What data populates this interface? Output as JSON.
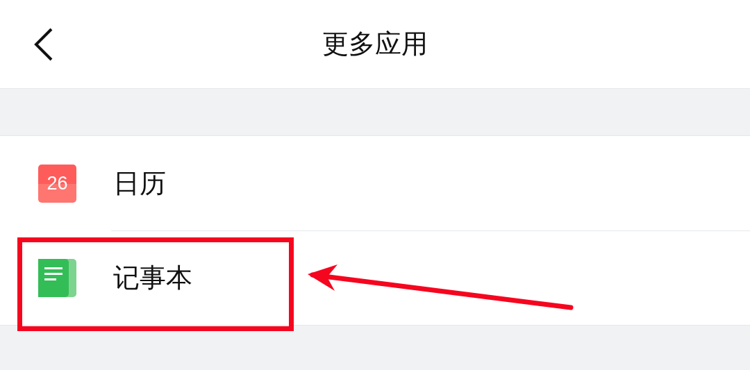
{
  "header": {
    "title": "更多应用"
  },
  "apps": [
    {
      "kind": "calendar",
      "icon_text": "26",
      "label": "日历",
      "highlighted": false
    },
    {
      "kind": "notepad",
      "label": "记事本",
      "highlighted": true
    }
  ]
}
